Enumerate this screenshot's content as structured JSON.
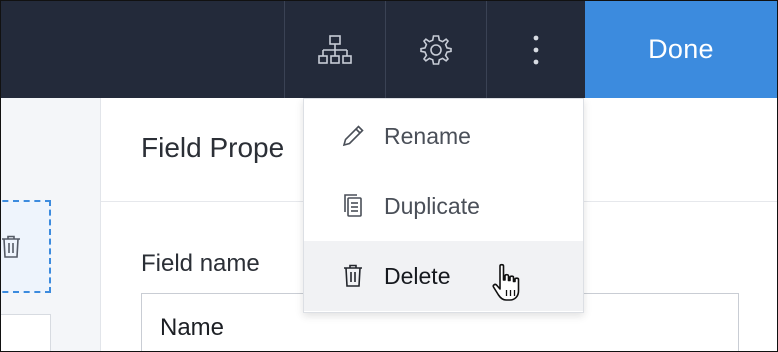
{
  "toolbar": {
    "icons": [
      "sitemap-icon",
      "gear-icon",
      "more-vertical-icon"
    ],
    "done_label": "Done",
    "background": "#232a3a",
    "accent": "#3c8bde"
  },
  "panel": {
    "title": "Field Prope",
    "field_name_label": "Field name",
    "field_name_value": "Name"
  },
  "menu": {
    "items": [
      {
        "label": "Rename",
        "icon": "pencil-icon"
      },
      {
        "label": "Duplicate",
        "icon": "copy-icon"
      },
      {
        "label": "Delete",
        "icon": "trash-icon",
        "hovered": true
      }
    ]
  }
}
